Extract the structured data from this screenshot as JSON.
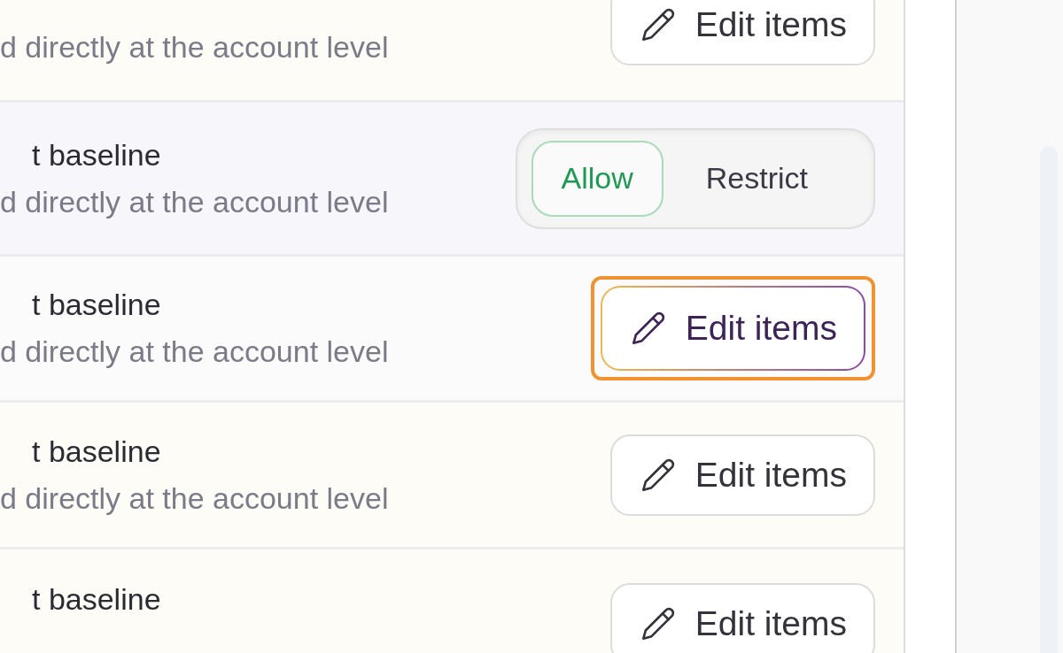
{
  "rows": [
    {
      "title": null,
      "description": "d directly at the account level",
      "control": {
        "kind": "edit",
        "label": "Edit items",
        "highlighted": false
      }
    },
    {
      "title": "t baseline",
      "description": "d directly at the account level",
      "control": {
        "kind": "toggle",
        "options": [
          {
            "label": "Allow",
            "selected": true
          },
          {
            "label": "Restrict",
            "selected": false
          }
        ]
      }
    },
    {
      "title": "t baseline",
      "description": "d directly at the account level",
      "control": {
        "kind": "edit",
        "label": "Edit items",
        "highlighted": true
      }
    },
    {
      "title": "t baseline",
      "description": "d directly at the account level",
      "control": {
        "kind": "edit",
        "label": "Edit items",
        "highlighted": false
      }
    },
    {
      "title": "t baseline",
      "control": {
        "kind": "edit",
        "label": "Edit items",
        "highlighted": false
      }
    }
  ]
}
